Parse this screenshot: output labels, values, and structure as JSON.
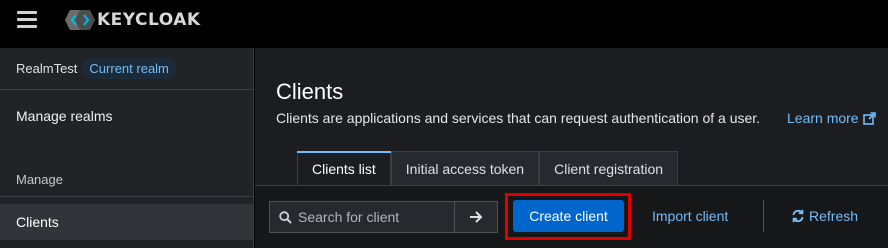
{
  "masthead": {
    "menu_icon": "hamburger-icon",
    "logo_icon": "keycloak-logo-icon",
    "logo_text": "KEYCLOAK"
  },
  "sidebar": {
    "realm_name": "RealmTest",
    "realm_badge": "Current realm",
    "manage_realms": "Manage realms",
    "section_label": "Manage",
    "items": [
      {
        "label": "Clients",
        "active": true
      }
    ]
  },
  "header": {
    "title": "Clients",
    "description": "Clients are applications and services that can request authentication of a user.",
    "learn_more": "Learn more",
    "learn_more_icon": "external-link-icon"
  },
  "tabs": [
    {
      "label": "Clients list",
      "active": true
    },
    {
      "label": "Initial access token",
      "active": false
    },
    {
      "label": "Client registration",
      "active": false
    }
  ],
  "toolbar": {
    "search_placeholder": "Search for client",
    "search_value": "",
    "search_icon": "search-icon",
    "go_icon": "arrow-right-icon",
    "create_label": "Create client",
    "import_label": "Import client",
    "refresh_label": "Refresh",
    "refresh_icon": "sync-icon"
  },
  "colors": {
    "accent": "#0066cc",
    "link": "#73bcf7",
    "highlight": "#e00000",
    "background": "#1b1d21"
  }
}
